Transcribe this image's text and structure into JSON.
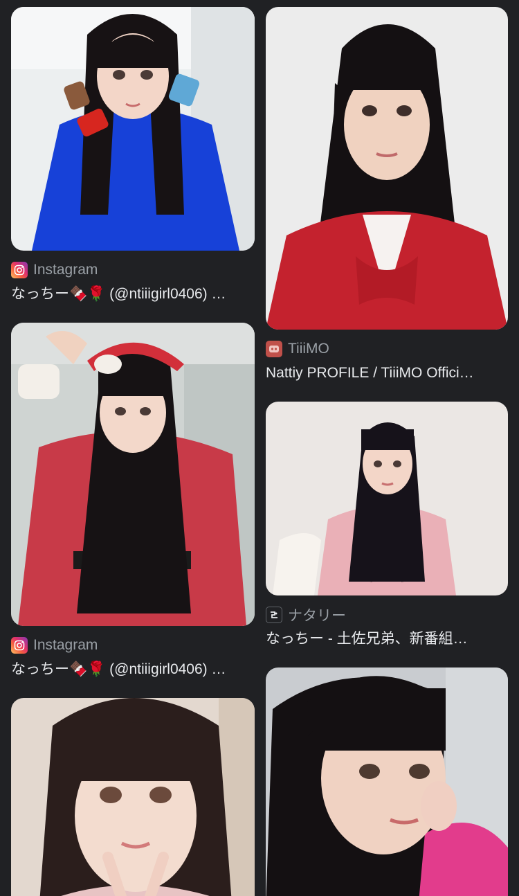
{
  "results": [
    {
      "source": "Instagram",
      "favicon": "instagram-icon",
      "title": "なっちー🍫🌹 (@ntiiigirl0406) …",
      "bg": "#eceff0",
      "outfit": "#1741d8",
      "hair": "#171214"
    },
    {
      "source": "TiiiMO",
      "favicon": "tiiimo-icon",
      "title": "Nattiy PROFILE / TiiiMO Offici…",
      "bg": "#ececec",
      "outfit": "#c4222e",
      "hair": "#141012"
    },
    {
      "source": "Instagram",
      "favicon": "instagram-icon",
      "title": "なっちー🍫🌹 (@ntiiigirl0406) …",
      "bg": "#cfd4d2",
      "outfit": "#c83a48",
      "hair": "#161214"
    },
    {
      "source": "ナタリー",
      "favicon": "natalie-icon",
      "title": "なっちー - 土佐兄弟、新番組…",
      "bg": "#ebe7e4",
      "outfit": "#eab0b7",
      "hair": "#16121a"
    },
    {
      "source": "",
      "favicon": "",
      "title": "",
      "bg": "#e3d8cf",
      "outfit": "#e8c4c4",
      "hair": "#2b1e1c"
    },
    {
      "source": "",
      "favicon": "",
      "title": "",
      "bg": "#c9ccd0",
      "outfit": "#e23c8c",
      "hair": "#141012"
    }
  ]
}
